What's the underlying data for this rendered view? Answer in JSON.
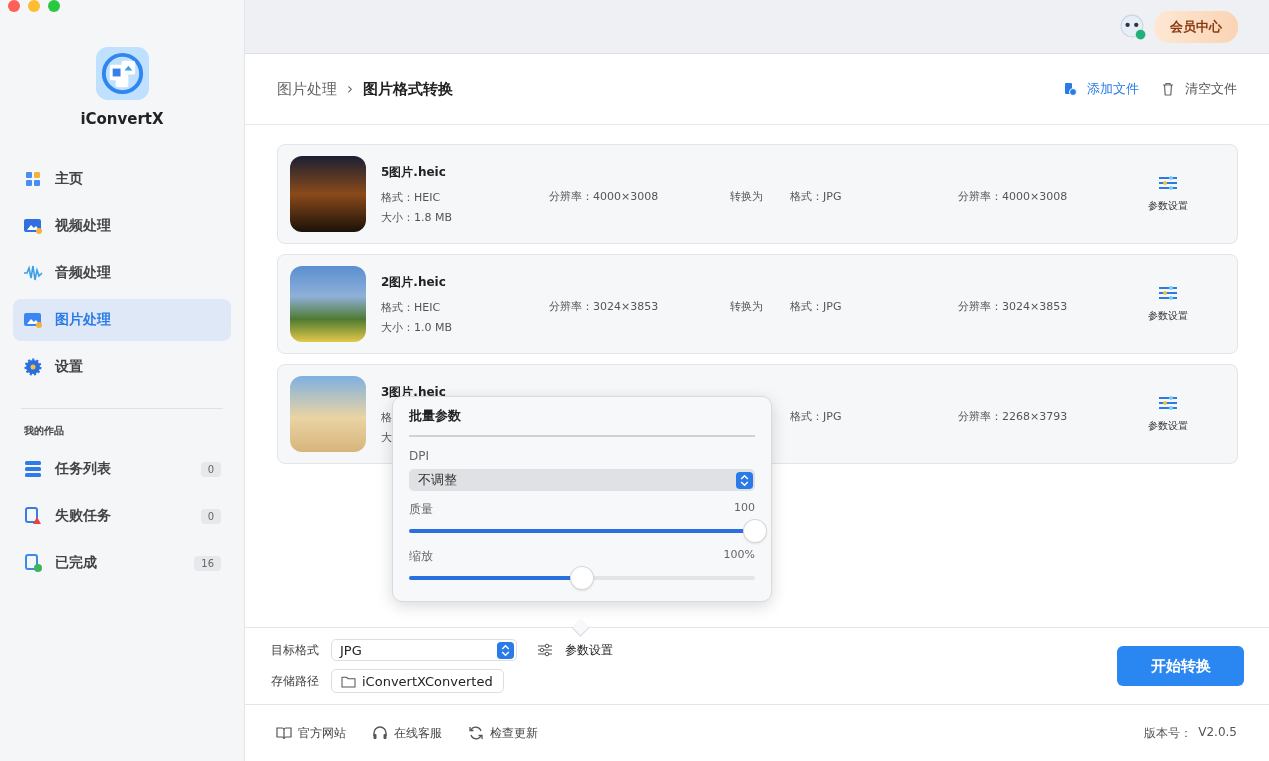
{
  "app": {
    "name": "iConvertX"
  },
  "sidebar": {
    "items": [
      {
        "label": "主页",
        "kind": "home",
        "selected": false
      },
      {
        "label": "视频处理",
        "kind": "video",
        "selected": false
      },
      {
        "label": "音频处理",
        "kind": "audio",
        "selected": false
      },
      {
        "label": "图片处理",
        "kind": "image",
        "selected": true
      },
      {
        "label": "设置",
        "kind": "settings",
        "selected": false
      }
    ],
    "section_title": "我的作品",
    "works": [
      {
        "label": "任务列表",
        "kind": "tasks",
        "count": "0"
      },
      {
        "label": "失败任务",
        "kind": "failed",
        "count": "0"
      },
      {
        "label": "已完成",
        "kind": "done",
        "count": "16"
      }
    ]
  },
  "topbar": {
    "member_button": "会员中心"
  },
  "breadcrumb": {
    "parent": "图片处理",
    "separator": "›",
    "current": "图片格式转换"
  },
  "actions": {
    "add": "添加文件",
    "clear": "清空文件"
  },
  "files": [
    {
      "name": "5图片.heic",
      "format": "格式：HEIC",
      "size": "大小：1.8 MB",
      "resolution": "分辨率：4000×3008",
      "convert_to": "转换为",
      "target_format": "格式：JPG",
      "target_resolution": "分辨率：4000×3008",
      "settings": "参数设置"
    },
    {
      "name": "2图片.heic",
      "format": "格式：HEIC",
      "size": "大小：1.0 MB",
      "resolution": "分辨率：3024×3853",
      "convert_to": "转换为",
      "target_format": "格式：JPG",
      "target_resolution": "分辨率：3024×3853",
      "settings": "参数设置"
    },
    {
      "name": "3图片.heic",
      "format": "格",
      "size": "大",
      "target_format": "格式：JPG",
      "target_resolution": "分辨率：2268×3793",
      "settings": "参数设置"
    }
  ],
  "popover": {
    "title": "批量参数",
    "dpi_label": "DPI",
    "dpi_value": "不调整",
    "sliders": [
      {
        "label": "质量",
        "reading": "100",
        "level": 1.0
      },
      {
        "label": "缩放",
        "reading": "100%",
        "level": 0.5
      }
    ]
  },
  "bottom": {
    "format_label": "目标格式",
    "format_value": "JPG",
    "params": "参数设置",
    "path_label": "存储路径",
    "path_value": "iConvertXConverted",
    "start": "开始转换"
  },
  "footer": {
    "links": [
      {
        "label": "官方网站",
        "kind": "book"
      },
      {
        "label": "在线客服",
        "kind": "headset"
      },
      {
        "label": "检查更新",
        "kind": "refresh"
      }
    ],
    "version_label": "版本号：",
    "version": "V2.0.5"
  }
}
